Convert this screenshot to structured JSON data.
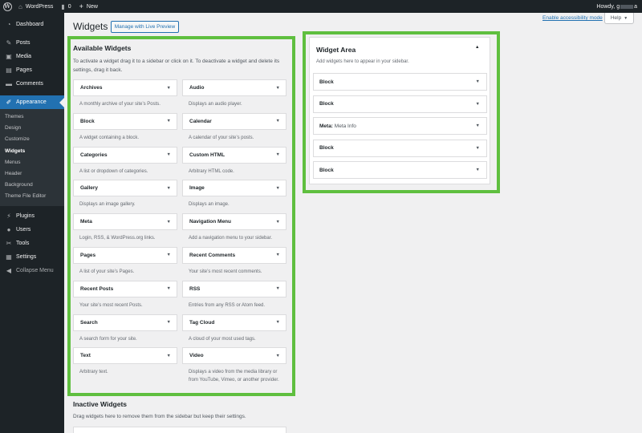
{
  "adminbar": {
    "site_name": "WordPress",
    "comments_count": "0",
    "new_label": "New",
    "howdy_prefix": "Howdy, g",
    "howdy_suffix": "a"
  },
  "sidebar": {
    "items_top": [
      {
        "label": "Dashboard",
        "icon": "dashboard-icon"
      },
      {
        "label": "Posts",
        "icon": "pin-icon"
      },
      {
        "label": "Media",
        "icon": "media-icon"
      },
      {
        "label": "Pages",
        "icon": "pages-icon"
      },
      {
        "label": "Comments",
        "icon": "comments-icon"
      },
      {
        "label": "Appearance",
        "icon": "brush-icon"
      }
    ],
    "submenu": [
      "Themes",
      "Design",
      "Customize",
      "Widgets",
      "Menus",
      "Header",
      "Background",
      "Theme File Editor"
    ],
    "items_bottom": [
      {
        "label": "Plugins",
        "icon": "plugin-icon"
      },
      {
        "label": "Users",
        "icon": "users-icon"
      },
      {
        "label": "Tools",
        "icon": "tools-icon"
      },
      {
        "label": "Settings",
        "icon": "settings-icon"
      },
      {
        "label": "Collapse Menu",
        "icon": "collapse-icon"
      }
    ]
  },
  "screen_meta": {
    "accessibility_link": "Enable accessibility mode",
    "help_label": "Help"
  },
  "page": {
    "title": "Widgets",
    "live_preview_button": "Manage with Live Preview"
  },
  "available_widgets": {
    "title": "Available Widgets",
    "description": "To activate a widget drag it to a sidebar or click on it. To deactivate a widget and delete its settings, drag it back.",
    "widgets": [
      {
        "name": "Archives",
        "desc": "A monthly archive of your site’s Posts."
      },
      {
        "name": "Audio",
        "desc": "Displays an audio player."
      },
      {
        "name": "Block",
        "desc": "A widget containing a block."
      },
      {
        "name": "Calendar",
        "desc": "A calendar of your site’s posts."
      },
      {
        "name": "Categories",
        "desc": "A list or dropdown of categories."
      },
      {
        "name": "Custom HTML",
        "desc": "Arbitrary HTML code."
      },
      {
        "name": "Gallery",
        "desc": "Displays an image gallery."
      },
      {
        "name": "Image",
        "desc": "Displays an image."
      },
      {
        "name": "Meta",
        "desc": "Login, RSS, & WordPress.org links."
      },
      {
        "name": "Navigation Menu",
        "desc": "Add a navigation menu to your sidebar."
      },
      {
        "name": "Pages",
        "desc": "A list of your site’s Pages."
      },
      {
        "name": "Recent Comments",
        "desc": "Your site’s most recent comments."
      },
      {
        "name": "Recent Posts",
        "desc": "Your site’s most recent Posts."
      },
      {
        "name": "RSS",
        "desc": "Entries from any RSS or Atom feed."
      },
      {
        "name": "Search",
        "desc": "A search form for your site."
      },
      {
        "name": "Tag Cloud",
        "desc": "A cloud of your most used tags."
      },
      {
        "name": "Text",
        "desc": "Arbitrary text."
      },
      {
        "name": "Video",
        "desc": "Displays a video from the media library or from YouTube, Vimeo, or another provider."
      }
    ]
  },
  "inactive_widgets": {
    "title": "Inactive Widgets",
    "description": "Drag widgets here to remove them from the sidebar but keep their settings."
  },
  "widget_area": {
    "title": "Widget Area",
    "description": "Add widgets here to appear in your sidebar.",
    "items": [
      {
        "name": "Block",
        "subtitle": ""
      },
      {
        "name": "Block",
        "subtitle": ""
      },
      {
        "name": "Meta:",
        "subtitle": "Meta Info"
      },
      {
        "name": "Block",
        "subtitle": ""
      },
      {
        "name": "Block",
        "subtitle": ""
      }
    ]
  },
  "colors": {
    "admin_dark": "#1d2327",
    "accent": "#2271b1",
    "highlight_frame": "#5fbf3f"
  }
}
